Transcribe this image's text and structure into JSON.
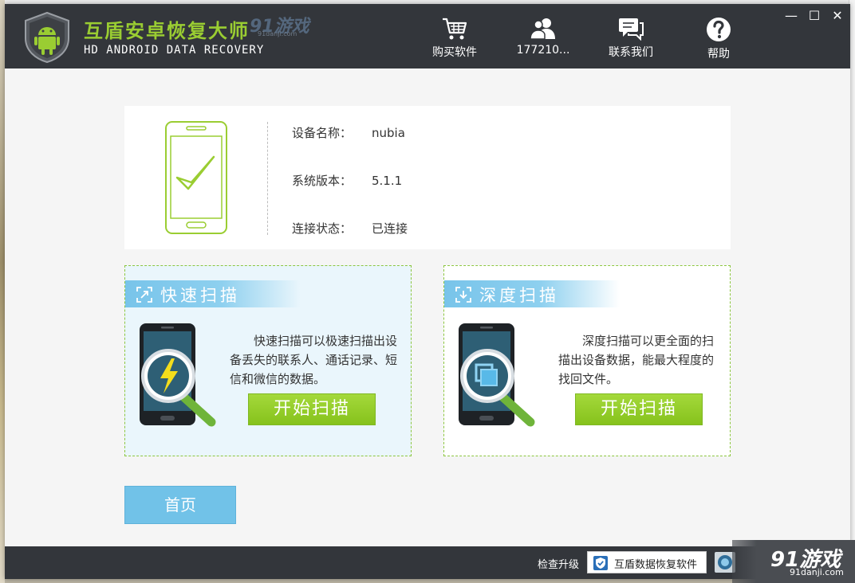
{
  "titlebar": {
    "app_name": "互盾安卓恢复大师",
    "app_subtitle": "HD ANDROID DATA RECOVERY",
    "logo_icon": "android-shield-icon"
  },
  "watermark": {
    "brand": "91游戏",
    "url": "91danji.com"
  },
  "nav": [
    {
      "label": "购买软件",
      "icon": "cart-icon"
    },
    {
      "label": "177210...",
      "icon": "user-group-icon"
    },
    {
      "label": "联系我们",
      "icon": "chat-icon"
    },
    {
      "label": "帮助",
      "icon": "help-icon"
    }
  ],
  "window_controls": {
    "minimize": "—",
    "maximize": "☐",
    "close": "✕"
  },
  "device": {
    "rows": [
      {
        "label": "设备名称：",
        "value": "nubia"
      },
      {
        "label": "系统版本：",
        "value": "5.1.1"
      },
      {
        "label": "连接状态：",
        "value": "已连接"
      }
    ]
  },
  "quick_scan": {
    "title": "快速扫描",
    "description": "快速扫描可以极速扫描出设备丢失的联系人、通话记录、短信和微信的数据。",
    "button": "开始扫描"
  },
  "deep_scan": {
    "title": "深度扫描",
    "description": "深度扫描可以更全面的扫描出设备数据，能最大程度的找回文件。",
    "button": "开始扫描"
  },
  "home_button": "首页",
  "footer": {
    "update_label": "检查升级",
    "promo_label": "互盾数据恢复软件"
  },
  "colors": {
    "titlebar_bg": "#33363b",
    "brand_green": "#9acd32",
    "button_green": "#86c21c",
    "accent_blue": "#71c2e8"
  }
}
